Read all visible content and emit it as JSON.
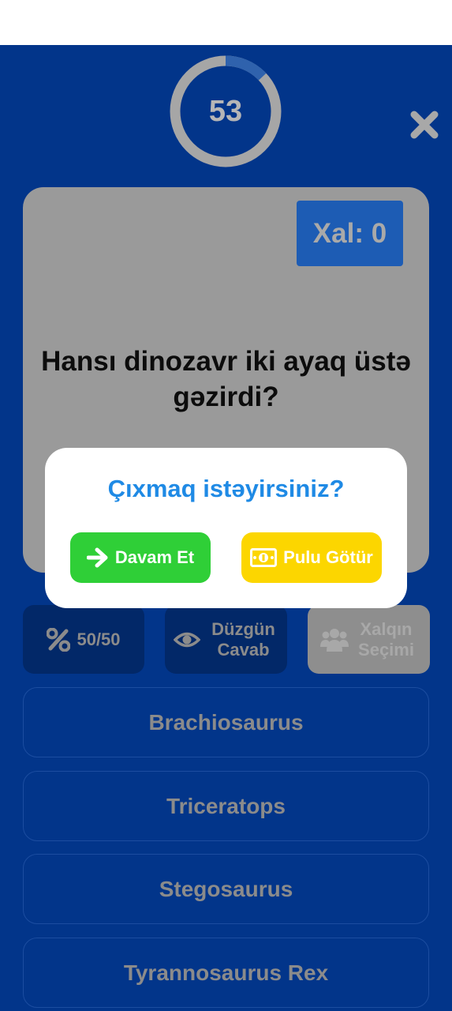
{
  "timer": {
    "value": "53",
    "progress": 0.13
  },
  "score": {
    "label": "Xal: 0"
  },
  "question": {
    "text": "Hansı dinozavr iki ayaq üstə gəzirdi?"
  },
  "lifelines": [
    {
      "label": "50/50",
      "icon": "percent-icon"
    },
    {
      "label": "Düzgün Cavab",
      "icon": "eye-icon"
    },
    {
      "label": "Xalqın Seçimi",
      "icon": "users-icon"
    }
  ],
  "answers": [
    "Brachiosaurus",
    "Triceratops",
    "Stegosaurus",
    "Tyrannosaurus Rex"
  ],
  "dialog": {
    "title": "Çıxmaq istəyirsiniz?",
    "continue_label": "Davam Et",
    "take_money_label": "Pulu Götür"
  },
  "colors": {
    "background": "#02358a",
    "continue": "#2fcf37",
    "take_money": "#fcd600",
    "dialog_title": "#1f8ae5"
  }
}
